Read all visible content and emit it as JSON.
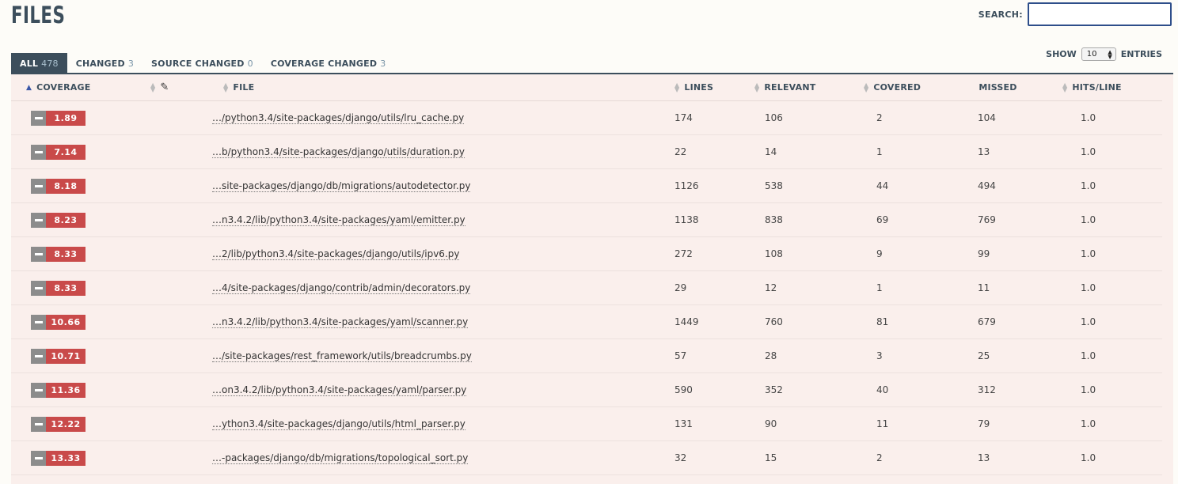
{
  "page": {
    "title": "FILES"
  },
  "search": {
    "label": "SEARCH:",
    "value": "",
    "placeholder": ""
  },
  "tabs": [
    {
      "label": "ALL",
      "count": "478",
      "active": true
    },
    {
      "label": "CHANGED",
      "count": "3",
      "active": false
    },
    {
      "label": "SOURCE CHANGED",
      "count": "0",
      "active": false
    },
    {
      "label": "COVERAGE CHANGED",
      "count": "3",
      "active": false
    }
  ],
  "show": {
    "label_before": "SHOW",
    "value": "10",
    "label_after": "ENTRIES"
  },
  "columns": {
    "coverage": "COVERAGE",
    "file": "FILE",
    "lines": "LINES",
    "relevant": "RELEVANT",
    "covered": "COVERED",
    "missed": "MISSED",
    "hits": "HITS/LINE"
  },
  "rows": [
    {
      "coverage": "1.89",
      "file": "…/python3.4/site-packages/django/utils/lru_cache.py",
      "lines": "174",
      "relevant": "106",
      "covered": "2",
      "missed": "104",
      "hits": "1.0"
    },
    {
      "coverage": "7.14",
      "file": "…b/python3.4/site-packages/django/utils/duration.py",
      "lines": "22",
      "relevant": "14",
      "covered": "1",
      "missed": "13",
      "hits": "1.0"
    },
    {
      "coverage": "8.18",
      "file": "…site-packages/django/db/migrations/autodetector.py",
      "lines": "1126",
      "relevant": "538",
      "covered": "44",
      "missed": "494",
      "hits": "1.0"
    },
    {
      "coverage": "8.23",
      "file": "…n3.4.2/lib/python3.4/site-packages/yaml/emitter.py",
      "lines": "1138",
      "relevant": "838",
      "covered": "69",
      "missed": "769",
      "hits": "1.0"
    },
    {
      "coverage": "8.33",
      "file": "…2/lib/python3.4/site-packages/django/utils/ipv6.py",
      "lines": "272",
      "relevant": "108",
      "covered": "9",
      "missed": "99",
      "hits": "1.0"
    },
    {
      "coverage": "8.33",
      "file": "…4/site-packages/django/contrib/admin/decorators.py",
      "lines": "29",
      "relevant": "12",
      "covered": "1",
      "missed": "11",
      "hits": "1.0"
    },
    {
      "coverage": "10.66",
      "file": "…n3.4.2/lib/python3.4/site-packages/yaml/scanner.py",
      "lines": "1449",
      "relevant": "760",
      "covered": "81",
      "missed": "679",
      "hits": "1.0"
    },
    {
      "coverage": "10.71",
      "file": "…/site-packages/rest_framework/utils/breadcrumbs.py",
      "lines": "57",
      "relevant": "28",
      "covered": "3",
      "missed": "25",
      "hits": "1.0"
    },
    {
      "coverage": "11.36",
      "file": "…on3.4.2/lib/python3.4/site-packages/yaml/parser.py",
      "lines": "590",
      "relevant": "352",
      "covered": "40",
      "missed": "312",
      "hits": "1.0"
    },
    {
      "coverage": "12.22",
      "file": "…ython3.4/site-packages/django/utils/html_parser.py",
      "lines": "131",
      "relevant": "90",
      "covered": "11",
      "missed": "79",
      "hits": "1.0"
    },
    {
      "coverage": "13.33",
      "file": "…-packages/django/db/migrations/topological_sort.py",
      "lines": "32",
      "relevant": "15",
      "covered": "2",
      "missed": "13",
      "hits": "1.0"
    }
  ],
  "colors": {
    "accent": "#3c4e5c",
    "badge_low": "#c94a4a",
    "minus_bg": "#8c8c8c",
    "row_bg": "#faefec"
  }
}
